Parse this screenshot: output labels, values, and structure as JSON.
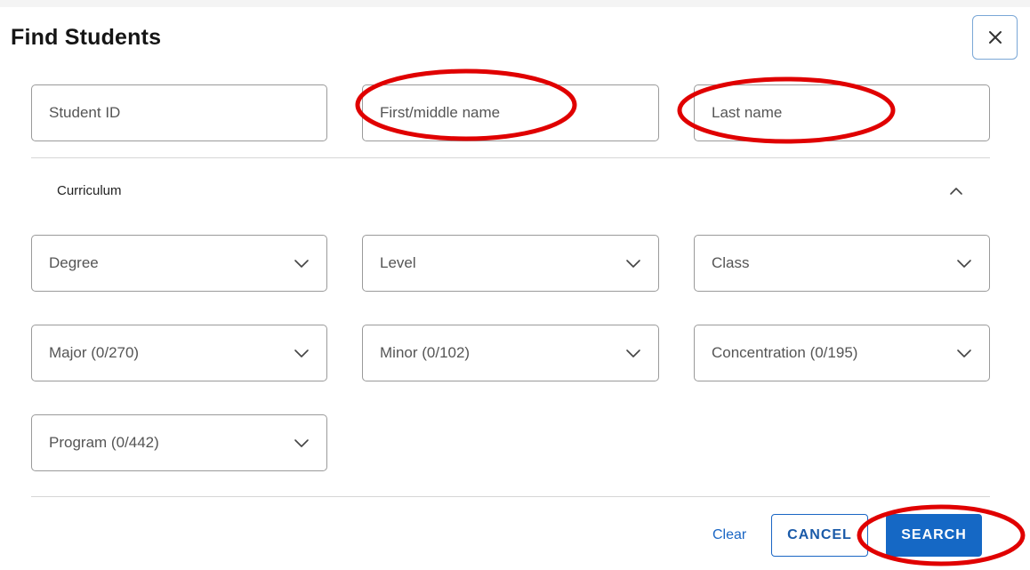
{
  "dialog": {
    "title": "Find Students",
    "close_icon": "close-icon"
  },
  "fields": {
    "student_id": {
      "placeholder": "Student ID",
      "value": ""
    },
    "first_middle_name": {
      "placeholder": "First/middle name",
      "value": ""
    },
    "last_name": {
      "placeholder": "Last name",
      "value": ""
    }
  },
  "curriculum": {
    "label": "Curriculum",
    "toggle_icon": "chevron-up-icon",
    "selects": {
      "degree": "Degree",
      "level": "Level",
      "class": "Class",
      "major": "Major (0/270)",
      "minor": "Minor (0/102)",
      "concentration": "Concentration (0/195)",
      "program": "Program (0/442)"
    },
    "select_icon": "chevron-down-icon"
  },
  "actions": {
    "clear": "Clear",
    "cancel": "CANCEL",
    "search": "SEARCH"
  },
  "colors": {
    "accent": "#1568c5",
    "annotation": "#e00000"
  }
}
